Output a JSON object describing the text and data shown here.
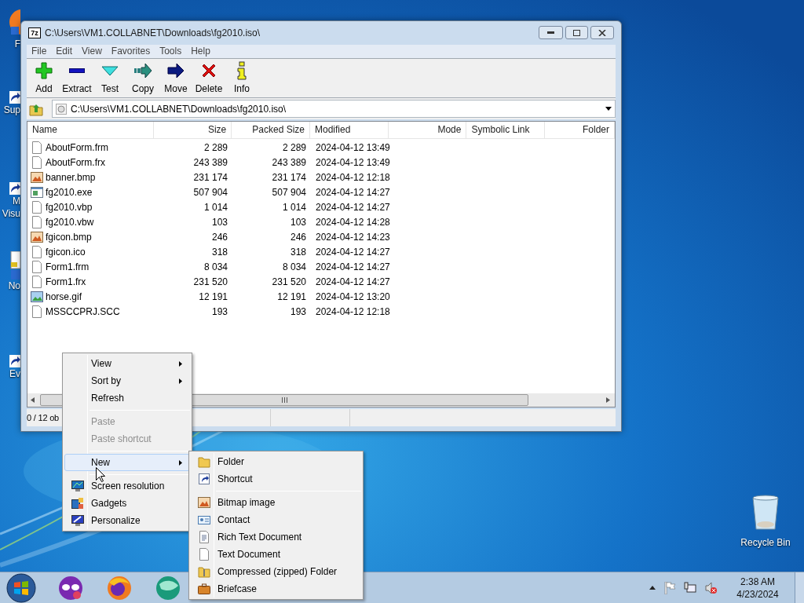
{
  "desktop_icons": [
    {
      "kind": "browser",
      "lines": [
        "F"
      ]
    },
    {
      "kind": "shortcut",
      "lines": [
        "Sup"
      ]
    },
    {
      "kind": "shortcut",
      "lines": [
        "M",
        "Visu"
      ]
    },
    {
      "kind": "notepad",
      "lines": [
        "No"
      ]
    },
    {
      "kind": "shortcut",
      "lines": [
        "Ev"
      ]
    }
  ],
  "recycle_bin": {
    "label": "Recycle Bin"
  },
  "window": {
    "logo": "7z",
    "title": "C:\\Users\\VM1.COLLABNET\\Downloads\\fg2010.iso\\",
    "menu": [
      "File",
      "Edit",
      "View",
      "Favorites",
      "Tools",
      "Help"
    ],
    "toolbar": [
      {
        "kind": "add",
        "label": "Add"
      },
      {
        "kind": "extract",
        "label": "Extract"
      },
      {
        "kind": "test",
        "label": "Test"
      },
      {
        "kind": "copy",
        "label": "Copy"
      },
      {
        "kind": "move",
        "label": "Move"
      },
      {
        "kind": "delete",
        "label": "Delete"
      },
      {
        "kind": "info",
        "label": "Info"
      }
    ],
    "address": "C:\\Users\\VM1.COLLABNET\\Downloads\\fg2010.iso\\",
    "columns": [
      "Name",
      "Size",
      "Packed Size",
      "Modified",
      "Mode",
      "Symbolic Link",
      "Folder"
    ],
    "rows": [
      {
        "kind": "document",
        "name": "AboutForm.frm",
        "size": "2 289",
        "packed_size": "2 289",
        "modified": "2024-04-12 13:49"
      },
      {
        "kind": "document",
        "name": "AboutForm.frx",
        "size": "243 389",
        "packed_size": "243 389",
        "modified": "2024-04-12 13:49"
      },
      {
        "kind": "bitmap",
        "name": "banner.bmp",
        "size": "231 174",
        "packed_size": "231 174",
        "modified": "2024-04-12 12:18"
      },
      {
        "kind": "exe",
        "name": "fg2010.exe",
        "size": "507 904",
        "packed_size": "507 904",
        "modified": "2024-04-12 14:27"
      },
      {
        "kind": "document",
        "name": "fg2010.vbp",
        "size": "1 014",
        "packed_size": "1 014",
        "modified": "2024-04-12 14:27"
      },
      {
        "kind": "document",
        "name": "fg2010.vbw",
        "size": "103",
        "packed_size": "103",
        "modified": "2024-04-12 14:28"
      },
      {
        "kind": "bitmap",
        "name": "fgicon.bmp",
        "size": "246",
        "packed_size": "246",
        "modified": "2024-04-12 14:23"
      },
      {
        "kind": "document",
        "name": "fgicon.ico",
        "size": "318",
        "packed_size": "318",
        "modified": "2024-04-12 14:27"
      },
      {
        "kind": "document",
        "name": "Form1.frm",
        "size": "8 034",
        "packed_size": "8 034",
        "modified": "2024-04-12 14:27"
      },
      {
        "kind": "document",
        "name": "Form1.frx",
        "size": "231 520",
        "packed_size": "231 520",
        "modified": "2024-04-12 14:27"
      },
      {
        "kind": "gif",
        "name": "horse.gif",
        "size": "12 191",
        "packed_size": "12 191",
        "modified": "2024-04-12 13:20"
      },
      {
        "kind": "document",
        "name": "MSSCCPRJ.SCC",
        "size": "193",
        "packed_size": "193",
        "modified": "2024-04-12 12:18"
      }
    ],
    "status": "0 / 12 ob"
  },
  "context_menu": {
    "items": [
      {
        "kind": "item",
        "label": "View",
        "has_submenu": true,
        "disabled": false,
        "selected": false
      },
      {
        "kind": "item",
        "label": "Sort by",
        "has_submenu": true,
        "disabled": false,
        "selected": false
      },
      {
        "kind": "item",
        "label": "Refresh",
        "has_submenu": false,
        "disabled": false,
        "selected": false
      },
      {
        "kind": "separator"
      },
      {
        "kind": "item",
        "label": "Paste",
        "has_submenu": false,
        "disabled": true,
        "selected": false
      },
      {
        "kind": "item",
        "label": "Paste shortcut",
        "has_submenu": false,
        "disabled": true,
        "selected": false
      },
      {
        "kind": "separator"
      },
      {
        "kind": "item",
        "label": "New",
        "has_submenu": true,
        "disabled": false,
        "selected": true
      },
      {
        "kind": "separator"
      },
      {
        "kind": "display",
        "label": "Screen resolution",
        "has_submenu": false,
        "disabled": false,
        "selected": false
      },
      {
        "kind": "gadgets",
        "label": "Gadgets",
        "has_submenu": false,
        "disabled": false,
        "selected": false
      },
      {
        "kind": "personalize",
        "label": "Personalize",
        "has_submenu": false,
        "disabled": false,
        "selected": false
      }
    ]
  },
  "new_submenu": {
    "items": [
      {
        "kind": "folder",
        "label": "Folder"
      },
      {
        "kind": "shortcut",
        "label": "Shortcut"
      },
      {
        "kind": "separator"
      },
      {
        "kind": "bitmap",
        "label": "Bitmap image"
      },
      {
        "kind": "contact",
        "label": "Contact"
      },
      {
        "kind": "richtext",
        "label": "Rich Text Document"
      },
      {
        "kind": "text",
        "label": "Text Document"
      },
      {
        "kind": "zip",
        "label": "Compressed (zipped) Folder"
      },
      {
        "kind": "briefcase",
        "label": "Briefcase"
      }
    ]
  },
  "taskbar": {
    "pinned": [
      {
        "kind": "start"
      },
      {
        "kind": "mask"
      },
      {
        "kind": "firefox"
      },
      {
        "kind": "globe"
      }
    ],
    "tray": {
      "time": "2:38 AM",
      "date": "4/23/2024"
    }
  }
}
